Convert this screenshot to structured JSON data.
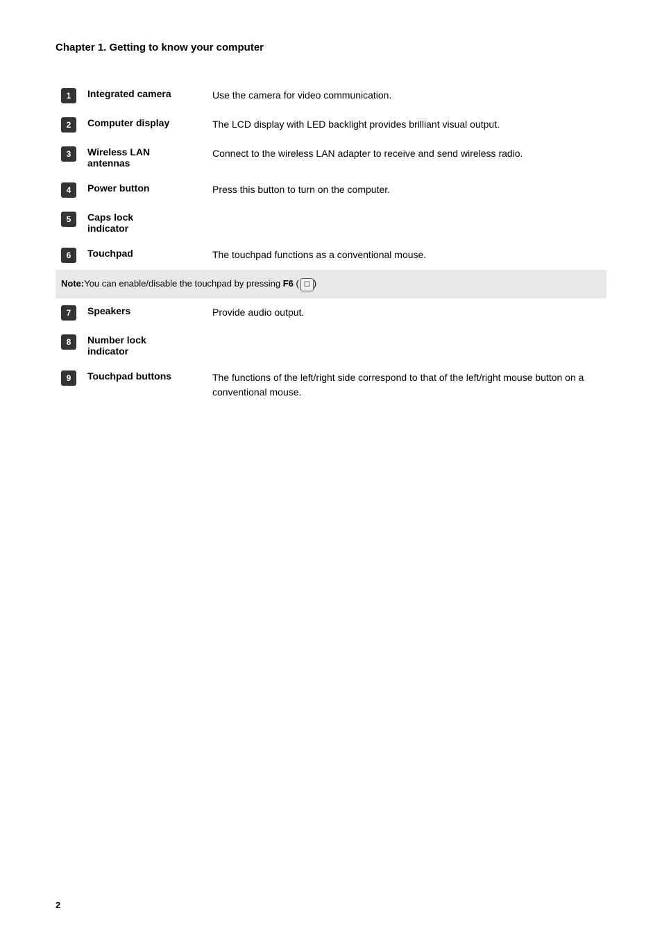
{
  "page": {
    "chapter_title": "Chapter 1. Getting to know your computer",
    "page_number": "2"
  },
  "items": [
    {
      "number": "1",
      "name": "Integrated camera",
      "description": "Use the camera for video communication.",
      "has_note": false
    },
    {
      "number": "2",
      "name": "Computer display",
      "description": "The LCD display with LED backlight provides brilliant visual output.",
      "has_note": false
    },
    {
      "number": "3",
      "name": "Wireless LAN antennas",
      "description": "Connect to the wireless LAN adapter to receive and send wireless radio.",
      "has_note": false
    },
    {
      "number": "4",
      "name": "Power button",
      "description": "Press this button to turn on the computer.",
      "has_note": false
    },
    {
      "number": "5",
      "name": "Caps lock indicator",
      "description": "",
      "has_note": false
    },
    {
      "number": "6",
      "name": "Touchpad",
      "description": "The touchpad functions as a conventional mouse.",
      "has_note": true,
      "note": "You can enable/disable the touchpad by pressing F6 ("
    },
    {
      "number": "7",
      "name": "Speakers",
      "description": "Provide audio output.",
      "has_note": false
    },
    {
      "number": "8",
      "name": "Number lock indicator",
      "description": "",
      "has_note": false
    },
    {
      "number": "9",
      "name": "Touchpad buttons",
      "description": "The functions of the left/right side correspond to that of the left/right mouse button on a conventional mouse.",
      "has_note": false
    }
  ],
  "labels": {
    "note": "Note:"
  }
}
